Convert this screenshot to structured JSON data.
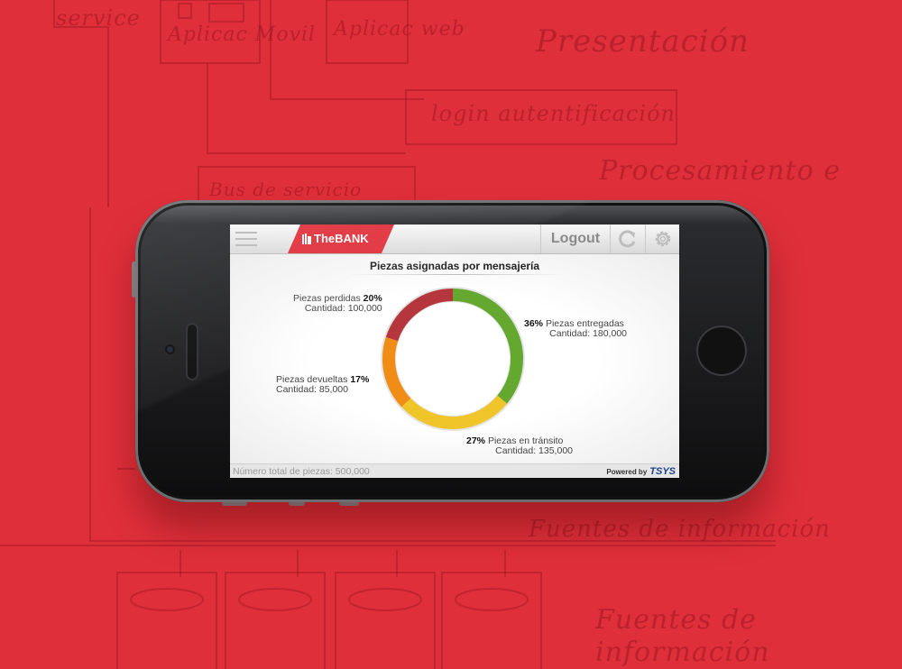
{
  "background": {
    "sketch_notes": [
      "service",
      "Aplicac Movil",
      "Aplicac web",
      "Presentación",
      "login autentificación",
      "Procesamiento e",
      "Bus de servicio",
      "Fuentes de información",
      "Fuentes de información"
    ]
  },
  "app": {
    "brand": "TheBANK",
    "header": {
      "logout_label": "Logout"
    },
    "colors": {
      "brand": "#e0313c"
    }
  },
  "chart_title": "Piezas asignadas por mensajería",
  "chart_data": {
    "type": "pie",
    "title": "Piezas asignadas por mensajería",
    "slices": [
      {
        "name": "Piezas entregadas",
        "pct": "36%",
        "value": 36,
        "cantidad": "Cantidad: 180,000",
        "color": "#64a82f"
      },
      {
        "name": "Piezas en tránsito",
        "pct": "27%",
        "value": 27,
        "cantidad": "Cantidad: 135,000",
        "color": "#f0c52a"
      },
      {
        "name": "Piezas devueltas",
        "pct": "17%",
        "value": 17,
        "cantidad": "Cantidad: 85,000",
        "color": "#ef8d16"
      },
      {
        "name": "Piezas perdidas",
        "pct": "20%",
        "value": 20,
        "cantidad": "Cantidad: 100,000",
        "color": "#b5363c"
      }
    ]
  },
  "footer": {
    "total_label": "Número total de piezas: 500,000",
    "powered_by": "Powered by",
    "powered_logo": "TSYS"
  }
}
